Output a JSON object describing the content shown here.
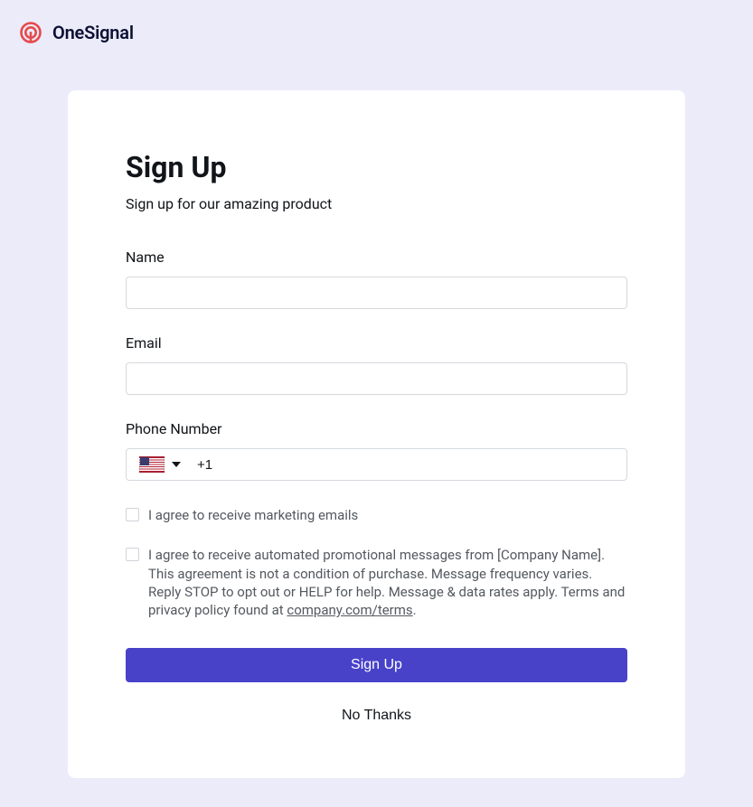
{
  "brand": {
    "name": "OneSignal"
  },
  "form": {
    "title": "Sign Up",
    "subtitle": "Sign up for our amazing product",
    "fields": {
      "name": {
        "label": "Name",
        "value": ""
      },
      "email": {
        "label": "Email",
        "value": ""
      },
      "phone": {
        "label": "Phone Number",
        "value": "+1",
        "country_flag": "us"
      }
    },
    "checkboxes": {
      "marketing": {
        "label": "I agree to receive marketing emails",
        "checked": false
      },
      "sms": {
        "text_before": "I agree to receive automated promotional messages from [Company Name]. This agreement is not a condition of purchase. Message frequency varies. Reply STOP to opt out or HELP for help. Message & data rates apply. Terms and privacy policy found at ",
        "link_text": "company.com/terms",
        "text_after": ".",
        "checked": false
      }
    },
    "buttons": {
      "submit": "Sign Up",
      "cancel": "No Thanks"
    }
  }
}
